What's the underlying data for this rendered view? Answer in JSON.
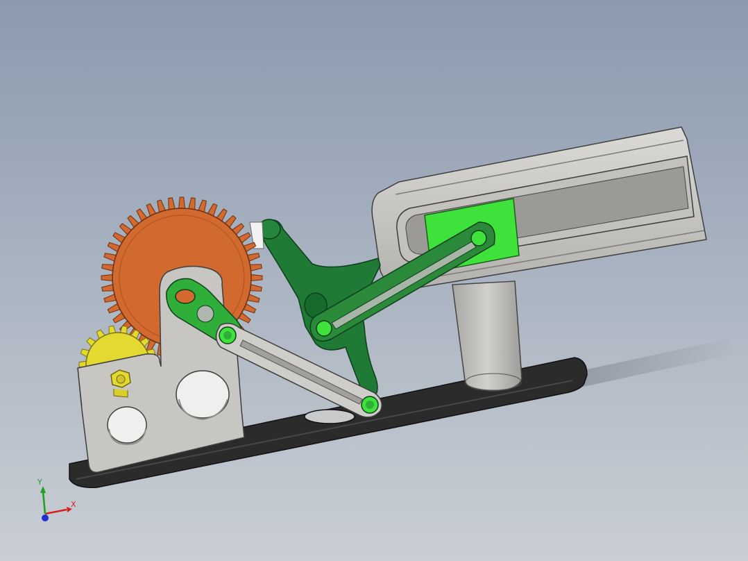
{
  "viewport": {
    "background_top": "#8b9aaf",
    "background_bottom": "#c9ced4"
  },
  "model": {
    "parts": [
      {
        "name": "base-plate",
        "color": "#2e2e2e"
      },
      {
        "name": "gear-housing",
        "color": "#c8c6c2"
      },
      {
        "name": "large-gear",
        "color": "#d2692f"
      },
      {
        "name": "pinion-gear",
        "color": "#e3d930"
      },
      {
        "name": "crank-link",
        "color": "#2fae3a"
      },
      {
        "name": "connecting-rod",
        "color": "#cfcdc9"
      },
      {
        "name": "rocker-arm",
        "color": "#1e7a35"
      },
      {
        "name": "slotted-link",
        "color": "#2a8a3a"
      },
      {
        "name": "slider-block",
        "color": "#3fe23a"
      },
      {
        "name": "guide-frame",
        "color": "#cbc9c5"
      },
      {
        "name": "support-column",
        "color": "#c2c0bc"
      }
    ]
  },
  "triad": {
    "x_label": "X",
    "y_label": "Y",
    "x_color": "#d62020",
    "y_color": "#20a020",
    "z_color": "#2030d0"
  }
}
